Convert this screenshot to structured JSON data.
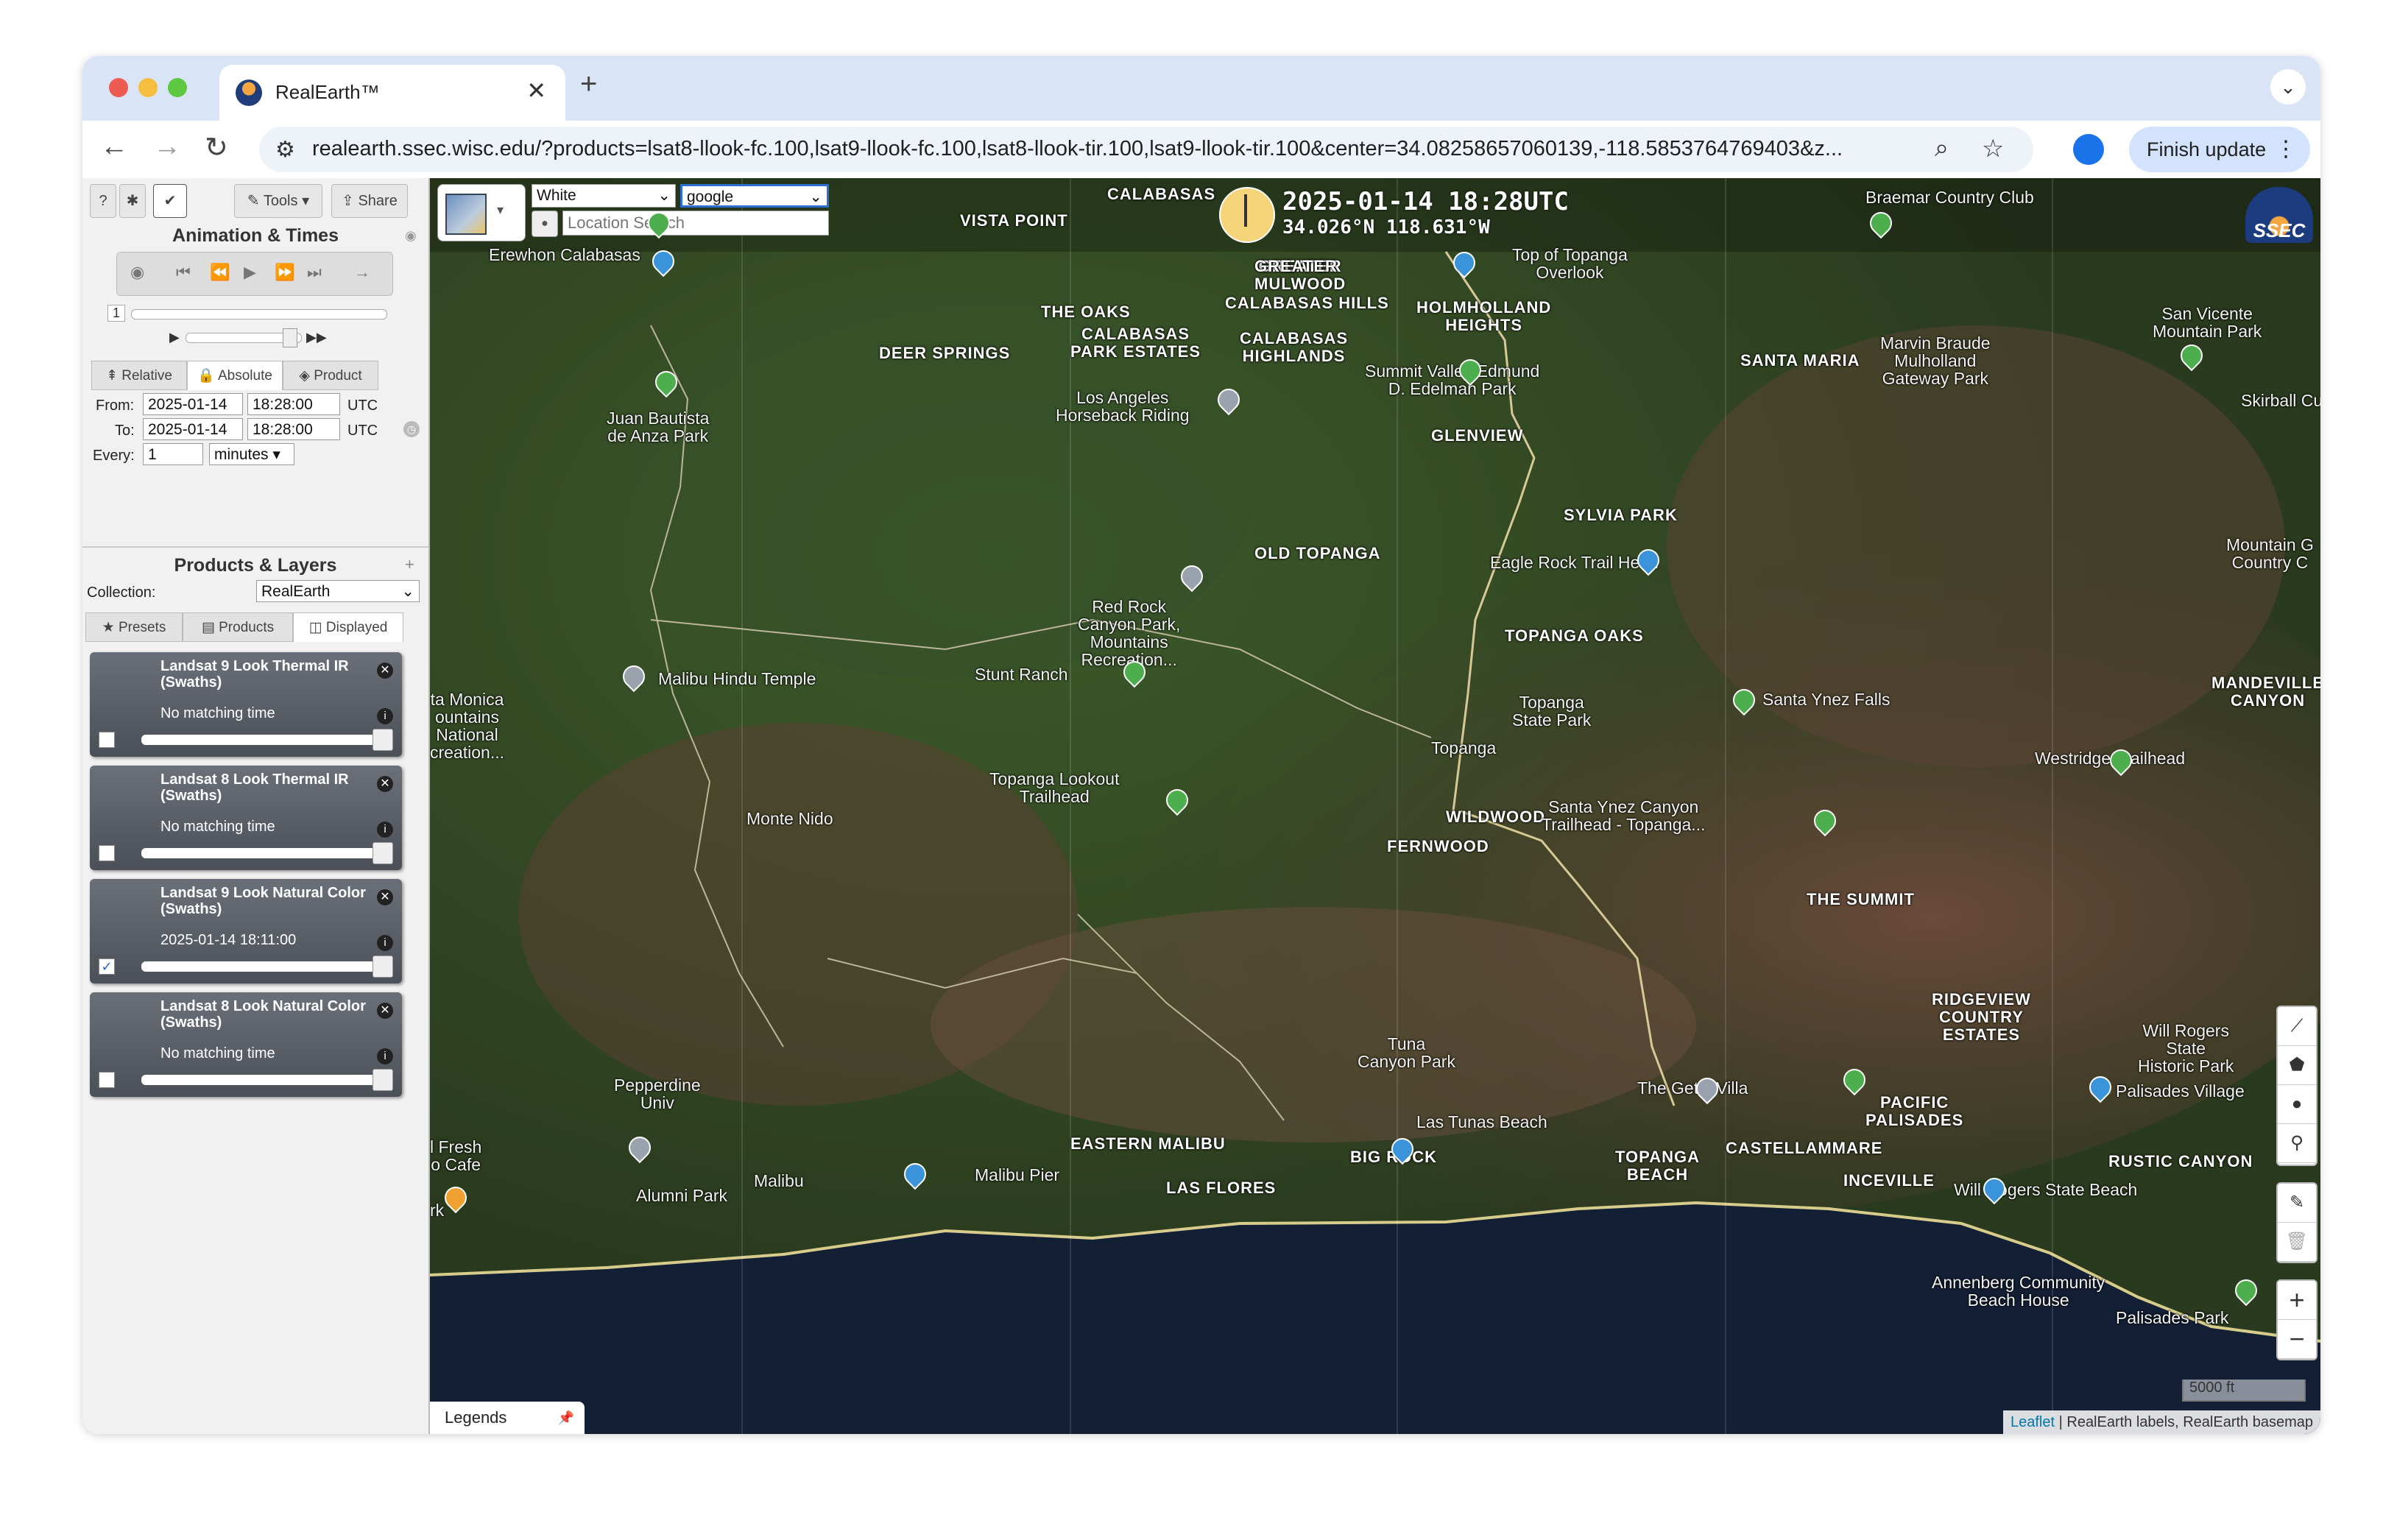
{
  "browser": {
    "tab_title": "RealEarth™",
    "url": "realearth.ssec.wisc.edu/?products=lsat8-llook-fc.100,lsat9-llook-fc.100,lsat8-llook-tir.100,lsat9-llook-tir.100&center=34.08258657060139,-118.5853764769403&z...",
    "finish_update": "Finish update"
  },
  "toolbar": {
    "tools": "Tools",
    "share": "Share"
  },
  "animation": {
    "title": "Animation & Times",
    "frame": "1",
    "tabs": [
      "Relative",
      "Absolute",
      "Product"
    ],
    "from_label": "From:",
    "from_date": "2025-01-14",
    "from_time": "18:28:00",
    "from_tz": "UTC",
    "to_label": "To:",
    "to_date": "2025-01-14",
    "to_time": "18:28:00",
    "to_tz": "UTC",
    "every_label": "Every:",
    "every_value": "1",
    "every_unit": "minutes"
  },
  "products": {
    "title": "Products & Layers",
    "collection_label": "Collection:",
    "collection_value": "RealEarth",
    "tabs": [
      "Presets",
      "Products",
      "Displayed"
    ],
    "layers": [
      {
        "name": "Landsat 9 Look Thermal IR (Swaths)",
        "time": "No matching time",
        "checked": ""
      },
      {
        "name": "Landsat 8 Look Thermal IR (Swaths)",
        "time": "No matching time",
        "checked": ""
      },
      {
        "name": "Landsat 9 Look Natural Color (Swaths)",
        "time": "2025-01-14 18:11:00",
        "checked": "✓"
      },
      {
        "name": "Landsat 8 Look Natural Color (Swaths)",
        "time": "No matching time",
        "checked": ""
      }
    ]
  },
  "map": {
    "label_color": "White",
    "basemap": "google",
    "search_placeholder": "Location Search",
    "datetime": "2025-01-14 18:28UTC",
    "coords": "34.026°N 118.631°W",
    "logo": "SSEC",
    "legends": "Legends",
    "scale": "5000 ft",
    "attribution_link": "Leaflet",
    "attribution_text": " | RealEarth labels, RealEarth basemap",
    "zoom_in": "+",
    "zoom_out": "−",
    "labels_bold": [
      [
        "CALABASAS",
        920,
        10
      ],
      [
        "VISTA POINT",
        720,
        46
      ],
      [
        "GREATER\nMULWOOD",
        1120,
        108
      ],
      [
        "GREATER",
        1120,
        108
      ],
      [
        "CALABASAS HILLS",
        1080,
        158
      ],
      [
        "THE OAKS",
        830,
        170
      ],
      [
        "HOLMHOLLAND\nHEIGHTS",
        1340,
        164
      ],
      [
        "CALABASAS\nPARK ESTATES",
        870,
        200
      ],
      [
        "CALABASAS\nHIGHLANDS",
        1100,
        206
      ],
      [
        "DEER SPRINGS",
        610,
        226
      ],
      [
        "SANTA MARIA",
        1780,
        236
      ],
      [
        "GLENVIEW",
        1360,
        338
      ],
      [
        "SYLVIA PARK",
        1540,
        446
      ],
      [
        "OLD TOPANGA",
        1120,
        498
      ],
      [
        "TOPANGA OAKS",
        1460,
        610
      ],
      [
        "WILDWOOD",
        1380,
        856
      ],
      [
        "FERNWOOD",
        1300,
        896
      ],
      [
        "THE SUMMIT",
        1870,
        968
      ],
      [
        "MANDEVILLE\nCANYON",
        2420,
        674
      ],
      [
        "RIDGEVIEW\nCOUNTRY\nESTATES",
        2040,
        1104
      ],
      [
        "PACIFIC\nPALISADES",
        1950,
        1244
      ],
      [
        "CASTELLAMMARE",
        1760,
        1306
      ],
      [
        "RUSTIC CANYON",
        2280,
        1324
      ],
      [
        "EASTERN MALIBU",
        870,
        1300
      ],
      [
        "BIG ROCK",
        1250,
        1318
      ],
      [
        "TOPANGA\nBEACH",
        1610,
        1318
      ],
      [
        "INCEVILLE",
        1920,
        1350
      ],
      [
        "LAS FLORES",
        1000,
        1360
      ]
    ],
    "labels_plain": [
      [
        "Braemar Country Club",
        1950,
        14
      ],
      [
        "Top of Topanga\nOverlook",
        1470,
        92
      ],
      [
        "Erewhon Calabasas",
        80,
        92
      ],
      [
        "Marvin Braude\nMulholland\nGateway Park",
        1970,
        212
      ],
      [
        "San Vicente\nMountain Park",
        2340,
        172
      ],
      [
        "Skirball Cu",
        2460,
        290
      ],
      [
        "Summit Valley Edmund\nD. Edelman Park",
        1270,
        250
      ],
      [
        "Los Angeles\nHorseback Riding",
        850,
        286
      ],
      [
        "Juan Bautista\nde Anza Park",
        240,
        314
      ],
      [
        "Eagle Rock Trail Head",
        1440,
        510
      ],
      [
        "Red Rock\nCanyon Park,\nMountains\nRecreation...",
        880,
        570
      ],
      [
        "Mountain G\nCountry C",
        2440,
        486
      ],
      [
        "Malibu Hindu Temple",
        310,
        668
      ],
      [
        "Stunt Ranch",
        740,
        662
      ],
      [
        "Topanga\nState Park",
        1470,
        700
      ],
      [
        "Santa Ynez Falls",
        1810,
        696
      ],
      [
        "ta Monica\nountains\nNational\ncreation...",
        0,
        696
      ],
      [
        "Topanga",
        1360,
        762
      ],
      [
        "Westridge Trailhead",
        2180,
        776
      ],
      [
        "Topanga Lookout\nTrailhead",
        760,
        804
      ],
      [
        "Monte Nido",
        430,
        858
      ],
      [
        "Santa Ynez Canyon\nTrailhead - Topanga...",
        1510,
        842
      ],
      [
        "Will Rogers\nState\nHistoric Park",
        2320,
        1146
      ],
      [
        "Palisades Village",
        2290,
        1228
      ],
      [
        "Tuna\nCanyon Park",
        1260,
        1164
      ],
      [
        "The Getty Villa",
        1640,
        1224
      ],
      [
        "Pepperdine\nUniv",
        250,
        1220
      ],
      [
        "Las Tunas Beach",
        1340,
        1270
      ],
      [
        "Malibu Pier",
        740,
        1342
      ],
      [
        "Malibu",
        440,
        1350
      ],
      [
        "Alumni Park",
        280,
        1370
      ],
      [
        "l Fresh\no Cafe",
        0,
        1304
      ],
      [
        "Will Rogers State Beach",
        2070,
        1362
      ],
      [
        "Annenberg Community\nBeach House",
        2040,
        1488
      ],
      [
        "Palisades Park",
        2290,
        1536
      ],
      [
        "rk",
        0,
        1390
      ]
    ]
  }
}
